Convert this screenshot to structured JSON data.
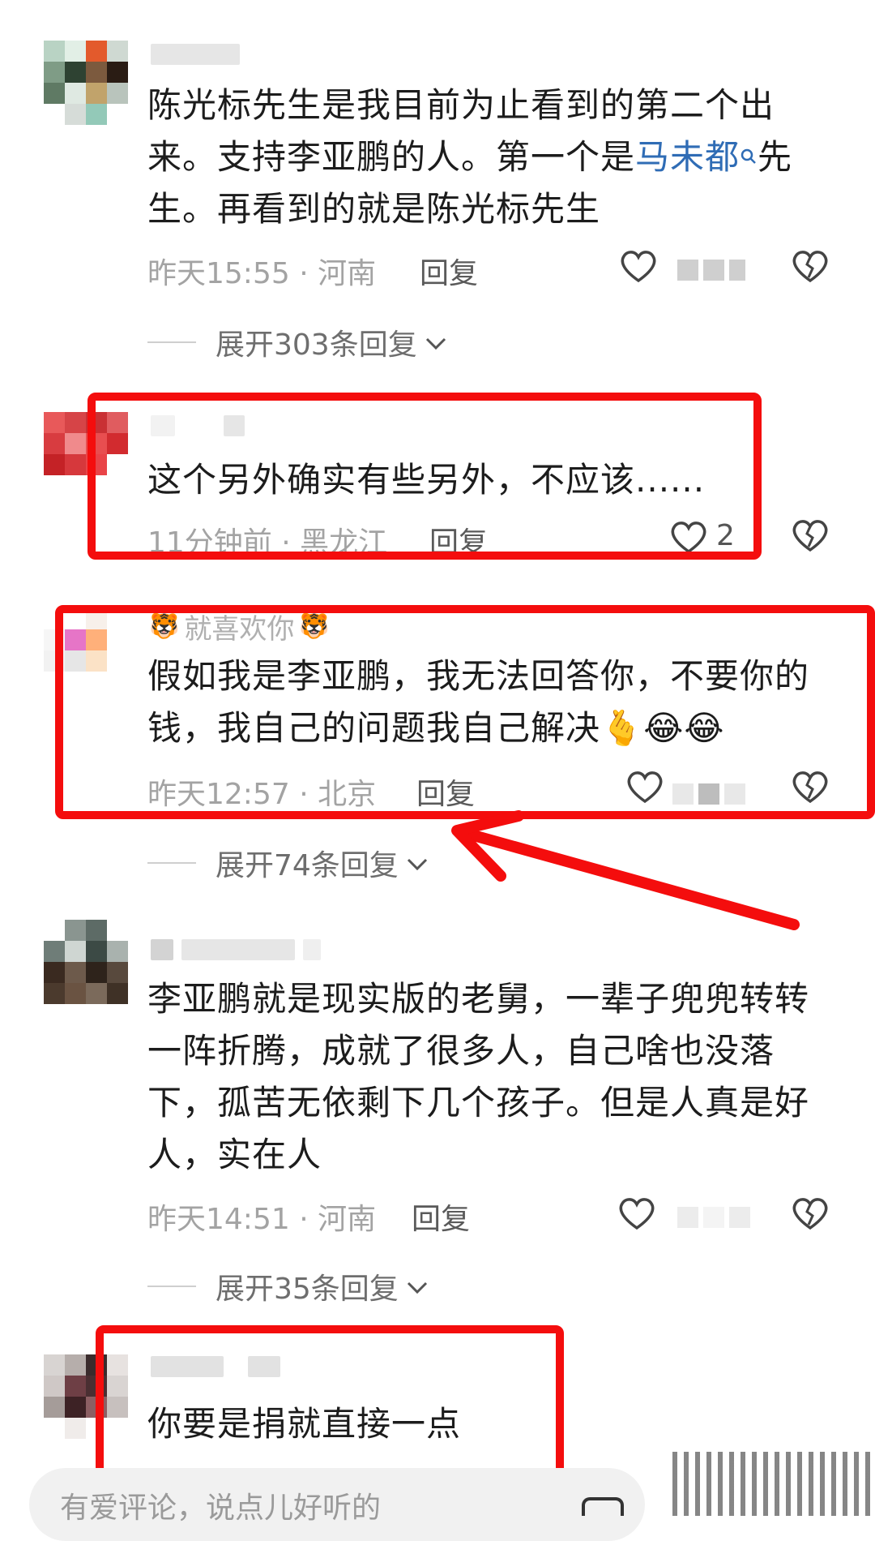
{
  "comments": [
    {
      "text_parts": [
        "陈光标先生是我目前为止看到的第二个出来。支持李亚鹏的人。第一个是",
        "马未都",
        "先生。再看到的就是陈光标先生"
      ],
      "time_location": "昨天15:55 · 河南",
      "reply_label": "回复",
      "expand_label": "展开303条回复"
    },
    {
      "text": "这个另外确实有些另外，不应该......",
      "time_location": "11分钟前 · 黑龙江",
      "reply_label": "回复",
      "like_count": "2"
    },
    {
      "username": "就喜欢你",
      "text": "假如我是李亚鹏，我无法回答你，不要你的钱，我自己的问题我自己解决",
      "emojis": "🫰😂😂",
      "time_location": "昨天12:57 · 北京",
      "reply_label": "回复",
      "expand_label": "展开74条回复"
    },
    {
      "text": "李亚鹏就是现实版的老舅，一辈子兜兜转转一阵折腾，成就了很多人，自己啥也没落下，孤苦无依剩下几个孩子。但是人真是好人，实在人",
      "time_location": "昨天14:51 · 河南",
      "reply_label": "回复",
      "expand_label": "展开35条回复"
    },
    {
      "text": "你要是捐就直接一点"
    }
  ],
  "input": {
    "placeholder": "有爱评论，说点儿好听的"
  },
  "colors": {
    "highlight_red": "#f40d0d",
    "link_blue": "#2f6cb5"
  }
}
